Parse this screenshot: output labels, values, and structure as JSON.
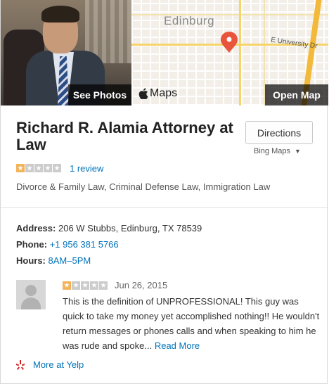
{
  "hero": {
    "see_photos": "See Photos",
    "map_provider": "Maps",
    "open_map": "Open Map",
    "map_city_label": "Edinburg",
    "map_street_label": "E University Dr"
  },
  "business": {
    "name": "Richard R. Alamia Attorney at Law",
    "directions_label": "Directions",
    "bing_maps_label": "Bing Maps",
    "rating": 1,
    "rating_max": 5,
    "review_count": "1 review",
    "categories": "Divorce & Family Law, Criminal Defense Law, Immigration Law"
  },
  "details": {
    "address_label": "Address:",
    "address_value": "206 W Stubbs, Edinburg, TX 78539",
    "phone_label": "Phone:",
    "phone_value": "+1 956 381 5766",
    "hours_label": "Hours:",
    "hours_value": "8AM–5PM"
  },
  "review": {
    "rating": 1,
    "date": "Jun 26, 2015",
    "text": "This is the definition of UNPROFESSIONAL! This guy was quick to take my money yet accomplished nothing!! He wouldn't return messages or phones calls and when speaking to him he was rude and spoke...",
    "read_more": "Read More"
  },
  "footer": {
    "more_at_yelp": "More at Yelp"
  },
  "colors": {
    "accent_link": "#0073bb",
    "star_active": "#f2b35b",
    "star_inactive": "#cccccc",
    "pin": "#e8553c",
    "yelp_red": "#d32323"
  }
}
